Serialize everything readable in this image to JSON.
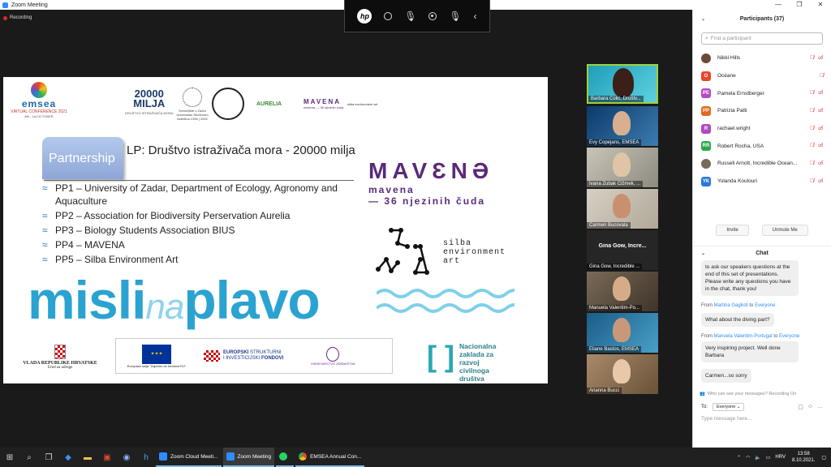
{
  "window": {
    "title": "Zoom Meeting",
    "recording": "Recording"
  },
  "slide": {
    "emsea": {
      "name": "emsea",
      "sub": "VIRTUAL CONFERENCE 2021",
      "dates": "8th - 1st OCTOBER"
    },
    "logos": {
      "milja_num": "20000",
      "milja_word": "MILJA",
      "milja_sub": "DRUŠTVO ISTRAŽIVAČA MORA",
      "uniz": "Sveučilište u Zadru Universitas Studiorum Iadertina 1396 | 2002",
      "aurelia": "AURELIA",
      "mavena_small": "MAVENA",
      "mavena_small_sub": "mavena — 36 njezinih čuda",
      "silba_small": "silba environment art"
    },
    "partnership": "Partnership",
    "lp": "LP: Društvo istraživača mora - 20000 milja",
    "partners": [
      "PP1 – University of Zadar, Department of Ecology, Agronomy and Aquaculture",
      "PP2 – Association for Biodiversity Perservation Aurelia",
      "PP3 – Biology Students Association BIUS",
      "PP4 – MAVENA",
      "PP5 – Silba Environment Art"
    ],
    "mavena": {
      "title": "MAVƐNƏ",
      "line1": "mavena",
      "line2": "— 36 njezinih čuda"
    },
    "silba": {
      "l1": "silba",
      "l2": "environment",
      "l3": "art"
    },
    "misli": {
      "a": "misli",
      "b": "na",
      "c": "plavo"
    },
    "croatia": {
      "l1": "VLADA REPUBLIKE HRVATSKE",
      "l2": "Ured za udruge"
    },
    "eu": {
      "caption": "Europska unija \"Zajedno do fondova EU\""
    },
    "esif": {
      "l1": "EUROPSKI",
      "l2": "STRUKTURNI",
      "l3": "I INVESTICIJSKI",
      "l4": "FONDOVI"
    },
    "ministry": "MINISTARSTVO ZDRAVSTVA",
    "nzrcd": {
      "l1": "Nacionalna",
      "l2": "zaklada za",
      "l3": "razvoj",
      "l4": "civilnoga",
      "l5": "društva"
    }
  },
  "videos": [
    {
      "name": "Barbara Čolić, Društv...",
      "active": true
    },
    {
      "name": "Evy Copejans, EMSEA"
    },
    {
      "name": "Ivana Zubak Čižmek, ..."
    },
    {
      "name": "Carmen Bucovala"
    },
    {
      "name": "Gina Gow, Incredible ...",
      "big": "Gina Gow, Incre..."
    },
    {
      "name": "Manuela Valentim-Po..."
    },
    {
      "name": "Eliane Bastos, EMSEA"
    },
    {
      "name": "Arianna Bucci"
    }
  ],
  "participants": {
    "title": "Participants (37)",
    "search_placeholder": "Find a participant",
    "list": [
      {
        "initials": "",
        "name": "Nikki Hills",
        "color": "#6b4a3a",
        "photo": true,
        "cam": true
      },
      {
        "initials": "O",
        "name": "Océane",
        "color": "#e8472b",
        "photo": false,
        "cam": false
      },
      {
        "initials": "PE",
        "name": "Pamela Ernstberger",
        "color": "#b84ac6",
        "photo": false,
        "cam": true
      },
      {
        "initials": "PP",
        "name": "Patrizia Patti",
        "color": "#e06a1e",
        "photo": false,
        "cam": true
      },
      {
        "initials": "R",
        "name": "rachael.wright",
        "color": "#b04ac0",
        "photo": false,
        "cam": true
      },
      {
        "initials": "RR",
        "name": "Robert Rocha, USA",
        "color": "#2aa84a",
        "photo": false,
        "cam": true
      },
      {
        "initials": "",
        "name": "Russell Arnott, Incredible Ocean...",
        "color": "#7a6a5a",
        "photo": true,
        "cam": true
      },
      {
        "initials": "YK",
        "name": "Yolanda Koulouri",
        "color": "#2a7ad8",
        "photo": false,
        "cam": true
      }
    ],
    "invite": "Invite",
    "unmute": "Unmute Me"
  },
  "chat": {
    "title": "Chat",
    "messages": [
      {
        "from": "",
        "to": "",
        "text": "to ask our speakers questions at the end of this set of presentations. Please write any questions you have in the chat, thank you!"
      },
      {
        "from": "Martina Gaglioti",
        "to": "Everyone",
        "text": "What about the diving part?"
      },
      {
        "from": "Manuela Valentim-Portugal",
        "to": "Everyone",
        "text": "Very inspiring project. Well done Barbara"
      },
      {
        "from": "",
        "to": "",
        "text": "Carmen...so sorry"
      }
    ],
    "from_label": "From",
    "to_word": "to",
    "note": "Who can see your messages? Recording On",
    "to_label": "To:",
    "to_value": "Everyone",
    "placeholder": "Type message here..."
  },
  "taskbar": {
    "apps": [
      {
        "label": "Zoom Cloud Meeti...",
        "color": "#2d8cff"
      },
      {
        "label": "Zoom Meeting",
        "color": "#2d8cff",
        "active": true
      },
      {
        "label": "",
        "color": "#25d366"
      },
      {
        "label": "EMSEA Annual Con...",
        "color": "#e0a21e"
      }
    ],
    "lang": "HRV",
    "time": "13:58",
    "date": "8.10.2021."
  }
}
